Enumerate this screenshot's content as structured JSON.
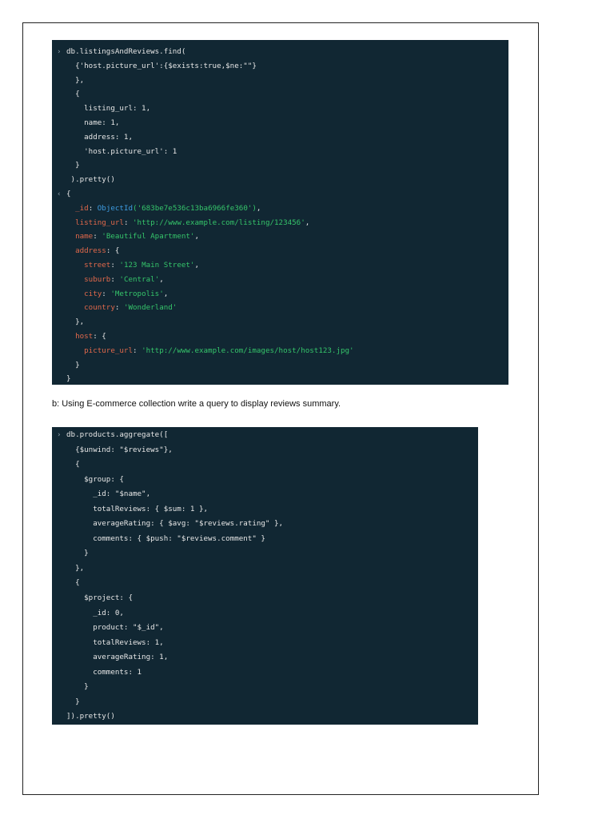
{
  "query1": {
    "lines": [
      {
        "marker": ">",
        "indent": 0,
        "segs": [
          [
            "",
            "db.listingsAndReviews.find("
          ]
        ]
      },
      {
        "indent": 2,
        "segs": [
          [
            "",
            "{'host.picture_url':{$exists:true,$ne:\"\"}"
          ]
        ]
      },
      {
        "indent": 2,
        "segs": [
          [
            "",
            "},"
          ]
        ]
      },
      {
        "indent": 2,
        "segs": [
          [
            "",
            "{"
          ]
        ]
      },
      {
        "indent": 4,
        "segs": [
          [
            "",
            "listing_url: 1,"
          ]
        ]
      },
      {
        "indent": 4,
        "segs": [
          [
            "",
            "name: 1,"
          ]
        ]
      },
      {
        "indent": 4,
        "segs": [
          [
            "",
            "address: 1,"
          ]
        ]
      },
      {
        "indent": 4,
        "segs": [
          [
            "",
            "'host.picture_url': 1"
          ]
        ]
      },
      {
        "indent": 2,
        "segs": [
          [
            "",
            "}"
          ]
        ]
      },
      {
        "indent": 1,
        "segs": [
          [
            "",
            ").pretty()"
          ]
        ]
      },
      {
        "marker": "<",
        "indent": 0,
        "segs": [
          [
            "",
            "{"
          ]
        ]
      },
      {
        "indent": 2,
        "segs": [
          [
            "k",
            "_id"
          ],
          [
            "",
            ": "
          ],
          [
            "f",
            "ObjectId"
          ],
          [
            "s",
            "('683be7e536c13ba6966fe360')"
          ],
          [
            "",
            ","
          ]
        ]
      },
      {
        "indent": 2,
        "segs": [
          [
            "k",
            "listing_url"
          ],
          [
            "",
            ": "
          ],
          [
            "s",
            "'http://www.example.com/listing/123456'"
          ],
          [
            "",
            ","
          ]
        ]
      },
      {
        "indent": 2,
        "segs": [
          [
            "k",
            "name"
          ],
          [
            "",
            ": "
          ],
          [
            "s",
            "'Beautiful Apartment'"
          ],
          [
            "",
            ","
          ]
        ]
      },
      {
        "indent": 2,
        "segs": [
          [
            "k",
            "address"
          ],
          [
            "",
            ": {"
          ]
        ]
      },
      {
        "indent": 4,
        "segs": [
          [
            "k",
            "street"
          ],
          [
            "",
            ": "
          ],
          [
            "s",
            "'123 Main Street'"
          ],
          [
            "",
            ","
          ]
        ]
      },
      {
        "indent": 4,
        "segs": [
          [
            "k",
            "suburb"
          ],
          [
            "",
            ": "
          ],
          [
            "s",
            "'Central'"
          ],
          [
            "",
            ","
          ]
        ]
      },
      {
        "indent": 4,
        "segs": [
          [
            "k",
            "city"
          ],
          [
            "",
            ": "
          ],
          [
            "s",
            "'Metropolis'"
          ],
          [
            "",
            ","
          ]
        ]
      },
      {
        "indent": 4,
        "segs": [
          [
            "k",
            "country"
          ],
          [
            "",
            ": "
          ],
          [
            "s",
            "'Wonderland'"
          ]
        ]
      },
      {
        "indent": 2,
        "segs": [
          [
            "",
            "},"
          ]
        ]
      },
      {
        "indent": 2,
        "segs": [
          [
            "k",
            "host"
          ],
          [
            "",
            ": {"
          ]
        ]
      },
      {
        "indent": 4,
        "segs": [
          [
            "k",
            "picture_url"
          ],
          [
            "",
            ": "
          ],
          [
            "s",
            "'http://www.example.com/images/host/host123.jpg'"
          ]
        ]
      },
      {
        "indent": 2,
        "segs": [
          [
            "",
            "}"
          ]
        ]
      },
      {
        "indent": 0,
        "segs": [
          [
            "",
            "}"
          ]
        ]
      }
    ]
  },
  "caption": "b: Using E-commerce collection write a query to display reviews summary.",
  "query2": {
    "lines": [
      {
        "marker": ">",
        "indent": 0,
        "segs": [
          [
            "",
            "db.products.aggregate(["
          ]
        ]
      },
      {
        "indent": 2,
        "segs": [
          [
            "",
            "{$unwind: \"$reviews\"},"
          ]
        ]
      },
      {
        "indent": 2,
        "segs": [
          [
            "",
            "{"
          ]
        ]
      },
      {
        "indent": 4,
        "segs": [
          [
            "",
            "$group: {"
          ]
        ]
      },
      {
        "indent": 6,
        "segs": [
          [
            "",
            "_id: \"$name\","
          ]
        ]
      },
      {
        "indent": 6,
        "segs": [
          [
            "",
            "totalReviews: { $sum: 1 },"
          ]
        ]
      },
      {
        "indent": 6,
        "segs": [
          [
            "",
            "averageRating: { $avg: \"$reviews.rating\" },"
          ]
        ]
      },
      {
        "indent": 6,
        "segs": [
          [
            "",
            "comments: { $push: \"$reviews.comment\" }"
          ]
        ]
      },
      {
        "indent": 4,
        "segs": [
          [
            "",
            "}"
          ]
        ]
      },
      {
        "indent": 2,
        "segs": [
          [
            "",
            "},"
          ]
        ]
      },
      {
        "indent": 2,
        "segs": [
          [
            "",
            "{"
          ]
        ]
      },
      {
        "indent": 4,
        "segs": [
          [
            "",
            "$project: {"
          ]
        ]
      },
      {
        "indent": 6,
        "segs": [
          [
            "",
            "_id: 0,"
          ]
        ]
      },
      {
        "indent": 6,
        "segs": [
          [
            "",
            "product: \"$_id\","
          ]
        ]
      },
      {
        "indent": 6,
        "segs": [
          [
            "",
            "totalReviews: 1,"
          ]
        ]
      },
      {
        "indent": 6,
        "segs": [
          [
            "",
            "averageRating: 1,"
          ]
        ]
      },
      {
        "indent": 6,
        "segs": [
          [
            "",
            "comments: 1"
          ]
        ]
      },
      {
        "indent": 4,
        "segs": [
          [
            "",
            "}"
          ]
        ]
      },
      {
        "indent": 2,
        "segs": [
          [
            "",
            "}"
          ]
        ]
      },
      {
        "indent": 0,
        "segs": [
          [
            "",
            "]).pretty()"
          ]
        ]
      }
    ]
  }
}
